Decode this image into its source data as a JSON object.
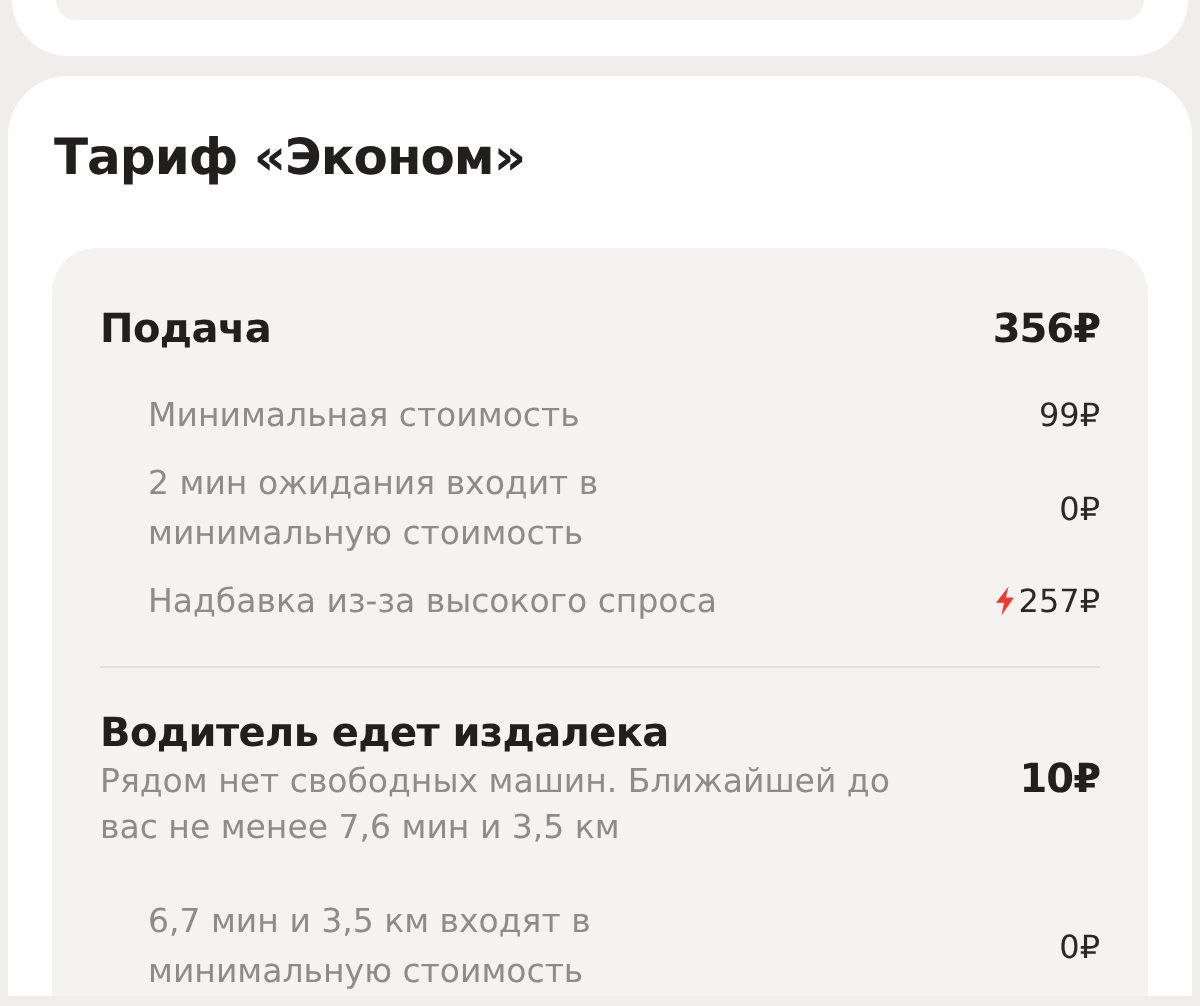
{
  "tariff_title": "Тариф «Эконом»",
  "sections": [
    {
      "title": "Подача",
      "price": "356₽",
      "items": [
        {
          "label": "Минимальная стоимость",
          "price": "99₽",
          "surge": false
        },
        {
          "label": "2 мин ожидания входит в минимальную стоимость",
          "price": "0₽",
          "surge": false
        },
        {
          "label": "Надбавка из-за высокого спроса",
          "price": "257₽",
          "surge": true
        }
      ]
    },
    {
      "title": "Водитель едет издалека",
      "description": "Рядом нет свободных машин. Ближайшей до вас не менее 7,6 мин и 3,5 км",
      "price": "10₽",
      "items": [
        {
          "label": "6,7 мин и 3,5 км входят в минимальную стоимость",
          "price": "0₽",
          "surge": false
        }
      ]
    }
  ]
}
